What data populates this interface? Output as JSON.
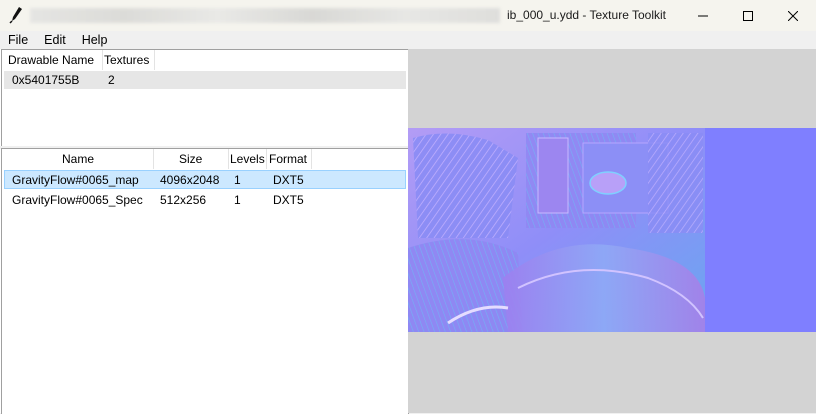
{
  "window": {
    "title": "ib_000_u.ydd - Texture Toolkit"
  },
  "menu": {
    "items": [
      "File",
      "Edit",
      "Help"
    ]
  },
  "drawables": {
    "headers": [
      "Drawable Name",
      "Textures"
    ],
    "rows": [
      {
        "name": "0x5401755B",
        "textures": "2"
      }
    ]
  },
  "textures": {
    "headers": [
      "Name",
      "Size",
      "Levels",
      "Format"
    ],
    "rows": [
      {
        "name": "GravityFlow#0065_map",
        "size": "4096x2048",
        "levels": "1",
        "format": "DXT5",
        "selected": true
      },
      {
        "name": "GravityFlow#0065_Spec",
        "size": "512x256",
        "levels": "1",
        "format": "DXT5",
        "selected": false
      }
    ]
  },
  "colors": {
    "selection_bg": "#cce8ff",
    "selection_border": "#99d1ff",
    "normal_map_base": "#7f7fff",
    "preview_bg": "#d3d3d3"
  }
}
